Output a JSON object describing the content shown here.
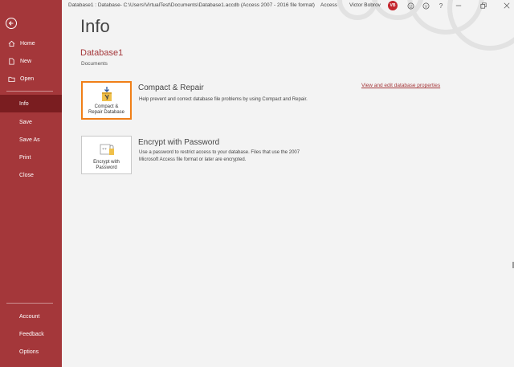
{
  "window": {
    "title": "Database1 : Database- C:\\Users\\VirtualTest\\Documents\\Database1.accdb (Access 2007 - 2016 file format)",
    "app_name": "Access",
    "user_name": "Victor Bobrov",
    "user_initials": "VB"
  },
  "sidebar": {
    "top_items": [
      {
        "label": "Home",
        "icon": "home-icon"
      },
      {
        "label": "New",
        "icon": "new-document-icon"
      },
      {
        "label": "Open",
        "icon": "folder-open-icon"
      }
    ],
    "items": [
      {
        "label": "Info",
        "active": true
      },
      {
        "label": "Save"
      },
      {
        "label": "Save As"
      },
      {
        "label": "Print"
      },
      {
        "label": "Close"
      }
    ],
    "bottom_items": [
      {
        "label": "Account"
      },
      {
        "label": "Feedback"
      },
      {
        "label": "Options"
      }
    ]
  },
  "main": {
    "title": "Info",
    "database_name": "Database1",
    "database_location": "Documents",
    "properties_link": "View and edit database properties",
    "features": [
      {
        "tile_label_line1": "Compact &",
        "tile_label_line2": "Repair Database",
        "title": "Compact & Repair",
        "description": "Help prevent and correct database file problems by using Compact and Repair."
      },
      {
        "tile_label_line1": "Encrypt with",
        "tile_label_line2": "Password",
        "title": "Encrypt with Password",
        "description_line1": "Use a password to restrict access to your database. Files that use the 2007",
        "description_line2": "Microsoft Access file format or later are encrypted."
      }
    ]
  },
  "colors": {
    "accent": "#a4373a",
    "accent_dark": "#7a1d20",
    "selection": "#f07f18"
  }
}
